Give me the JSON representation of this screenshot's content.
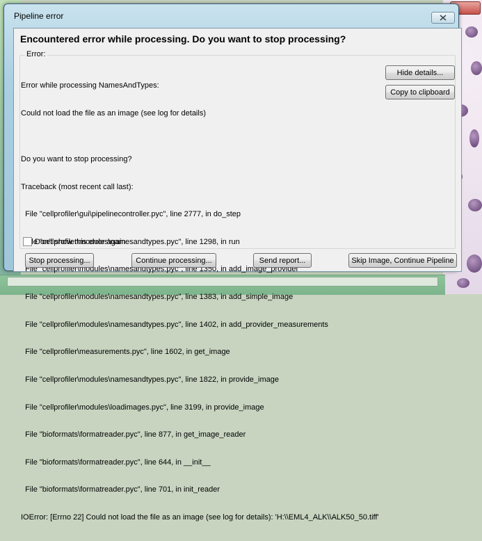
{
  "window": {
    "title": "Pipeline error",
    "close_icon": "close-icon",
    "accent_color": "#a9cfe1"
  },
  "dialog": {
    "header": "Encountered error while processing. Do you want to stop processing?",
    "group_label": "Error:",
    "lines": [
      "Error while processing NamesAndTypes:",
      "Could not load the file as an image (see log for details)",
      "",
      "Do you want to stop processing?",
      "Traceback (most recent call last):",
      "  File \"cellprofiler\\gui\\pipelinecontroller.pyc\", line 2777, in do_step",
      "  File \"cellprofiler\\modules\\namesandtypes.pyc\", line 1298, in run",
      "  File \"cellprofiler\\modules\\namesandtypes.pyc\", line 1350, in add_image_provider",
      "  File \"cellprofiler\\modules\\namesandtypes.pyc\", line 1383, in add_simple_image",
      "  File \"cellprofiler\\modules\\namesandtypes.pyc\", line 1402, in add_provider_measurements",
      "  File \"cellprofiler\\measurements.pyc\", line 1602, in get_image",
      "  File \"cellprofiler\\modules\\namesandtypes.pyc\", line 1822, in provide_image",
      "  File \"cellprofiler\\modules\\loadimages.pyc\", line 3199, in provide_image",
      "  File \"bioformats\\formatreader.pyc\", line 877, in get_image_reader",
      "  File \"bioformats\\formatreader.pyc\", line 644, in __init__",
      "  File \"bioformats\\formatreader.pyc\", line 701, in init_reader",
      "IOError: [Errno 22] Could not load the file as an image (see log for details): 'H:\\\\EML4_ALK\\\\ALK50_50.tiff'"
    ],
    "hide_details_label": "Hide details...",
    "copy_label": "Copy to clipboard",
    "dont_show_label": "Don't show this error again",
    "dont_show_checked": false,
    "stop_label": "Stop processing...",
    "continue_label": "Continue processing...",
    "report_label": "Send report...",
    "skip_label": "Skip Image, Continue Pipeline"
  }
}
